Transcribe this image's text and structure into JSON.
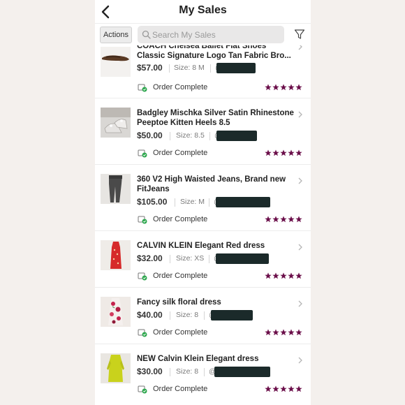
{
  "header": {
    "title": "My Sales"
  },
  "toolbar": {
    "actions_label": "Actions",
    "search_placeholder": "Search My Sales"
  },
  "colors": {
    "star": "#6b0f4a",
    "check": "#2fa84f"
  },
  "items": [
    {
      "title": "COACH Chelsea Ballet Flat Shoes Classic Signature Logo Tan Fabric Bro...",
      "price": "$57.00",
      "size": "Size: 8 M",
      "buyer": "@",
      "status": "Order Complete",
      "rating": 5
    },
    {
      "title": "Badgley Mischka Silver Satin Rhinestone Peeptoe Kitten Heels 8.5",
      "price": "$50.00",
      "size": "Size: 8.5",
      "buyer": "@",
      "status": "Order Complete",
      "rating": 5
    },
    {
      "title": "360 V2 High Waisted Jeans, Brand new FitJeans",
      "price": "$105.00",
      "size": "Size: M",
      "buyer": "@",
      "status": "Order Complete",
      "rating": 5
    },
    {
      "title": "CALVIN KLEIN Elegant Red dress",
      "price": "$32.00",
      "size": "Size: XS",
      "buyer": "@",
      "status": "Order Complete",
      "rating": 5
    },
    {
      "title": "Fancy silk floral dress",
      "price": "$40.00",
      "size": "Size: 8",
      "buyer": "@",
      "status": "Order Complete",
      "rating": 5
    },
    {
      "title": "NEW Calvin Klein Elegant dress",
      "price": "$30.00",
      "size": "Size: 8",
      "buyer": "@",
      "status": "Order Complete",
      "rating": 5
    }
  ]
}
